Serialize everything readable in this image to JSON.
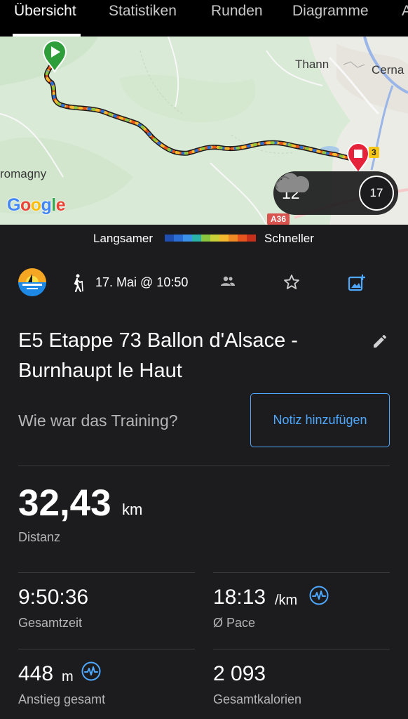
{
  "tabs": [
    {
      "label": "Übersicht",
      "active": true
    },
    {
      "label": "Statistiken",
      "active": false
    },
    {
      "label": "Runden",
      "active": false
    },
    {
      "label": "Diagramme",
      "active": false
    },
    {
      "label": "A",
      "active": false
    }
  ],
  "map": {
    "places": {
      "thann": "Thann",
      "cernay": "Cerna",
      "giromagny": "romagny"
    },
    "road_a36": "A36",
    "road_badge": "3",
    "google_logo": [
      "G",
      "o",
      "o",
      "g",
      "l",
      "e"
    ],
    "weather": {
      "temperature": "12°",
      "condition_icon": "cloud-icon",
      "wind": "17"
    }
  },
  "legend": {
    "slow_label": "Langsamer",
    "fast_label": "Schneller",
    "colors": [
      "#1f4fb0",
      "#2b6fd6",
      "#3a93e8",
      "#2ab3a8",
      "#8cc63f",
      "#c8d238",
      "#f5b82e",
      "#f08a24",
      "#e8541e",
      "#c8301c"
    ]
  },
  "activity": {
    "app_icon": "sunset-logo-icon",
    "type_icon": "hiking-icon",
    "date": "17. Mai @ 10:50",
    "title": "E5 Etappe 73 Ballon d'Alsace - Burnhaupt le Haut"
  },
  "note": {
    "question": "Wie war das Training?",
    "button_label": "Notiz hinzufügen"
  },
  "stats": {
    "distance": {
      "value": "32,43",
      "unit": "km",
      "label": "Distanz"
    },
    "total_time": {
      "value": "9:50:36",
      "label": "Gesamtzeit"
    },
    "pace": {
      "value": "18:13",
      "unit": "/km",
      "label": "Ø Pace"
    },
    "ascent": {
      "value": "448",
      "unit": "m",
      "label": "Anstieg gesamt"
    },
    "calories": {
      "value": "2 093",
      "label": "Gesamtkalorien"
    }
  },
  "colors": {
    "accent": "#4fa8ff",
    "start_marker": "#2e9e3a",
    "end_marker": "#e5243b"
  }
}
